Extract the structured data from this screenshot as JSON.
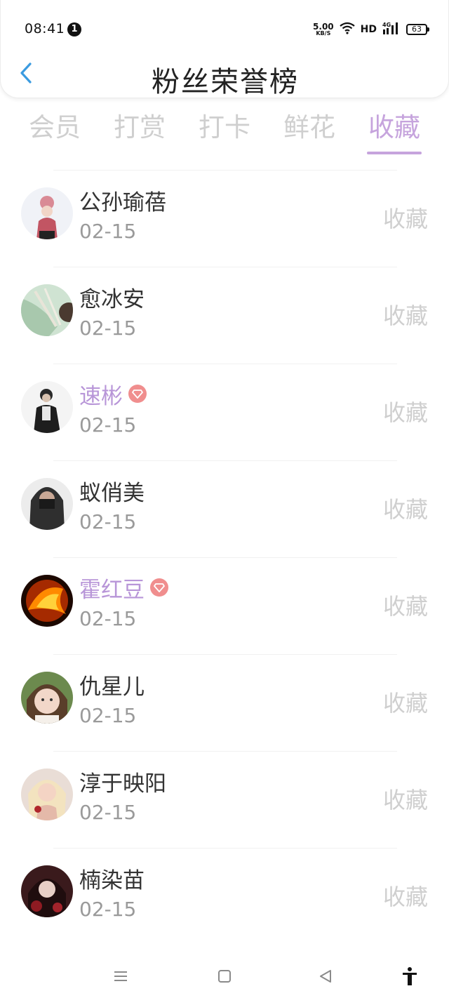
{
  "status_bar": {
    "time": "08:41",
    "notification_count": "1",
    "net_speed_value": "5.00",
    "net_speed_unit": "KB/S",
    "hd_label": "HD",
    "signal_label": "4G",
    "battery": "63"
  },
  "header": {
    "title": "粉丝荣誉榜"
  },
  "tabs": [
    {
      "label": "会员",
      "active": false
    },
    {
      "label": "打赏",
      "active": false
    },
    {
      "label": "打卡",
      "active": false
    },
    {
      "label": "鲜花",
      "active": false
    },
    {
      "label": "收藏",
      "active": true
    }
  ],
  "fans": [
    {
      "name": "公孙瑜蓓",
      "date": "02-15",
      "action": "收藏",
      "vip": false
    },
    {
      "name": "愈冰安",
      "date": "02-15",
      "action": "收藏",
      "vip": false
    },
    {
      "name": "速彬",
      "date": "02-15",
      "action": "收藏",
      "vip": true
    },
    {
      "name": "蚁俏美",
      "date": "02-15",
      "action": "收藏",
      "vip": false
    },
    {
      "name": "霍红豆",
      "date": "02-15",
      "action": "收藏",
      "vip": true
    },
    {
      "name": "仇星儿",
      "date": "02-15",
      "action": "收藏",
      "vip": false
    },
    {
      "name": "淳于映阳",
      "date": "02-15",
      "action": "收藏",
      "vip": false
    },
    {
      "name": "楠染苗",
      "date": "02-15",
      "action": "收藏",
      "vip": false
    }
  ],
  "colors": {
    "accent": "#c6a4dd",
    "vip_name": "#b896d8",
    "vip_badge": "#f08e8e",
    "back_arrow": "#3b9be0"
  },
  "icons": {
    "back": "chevron-left-icon",
    "vip": "diamond-icon",
    "nav": [
      "menu-icon",
      "home-square-icon",
      "back-triangle-icon",
      "accessibility-icon"
    ]
  }
}
